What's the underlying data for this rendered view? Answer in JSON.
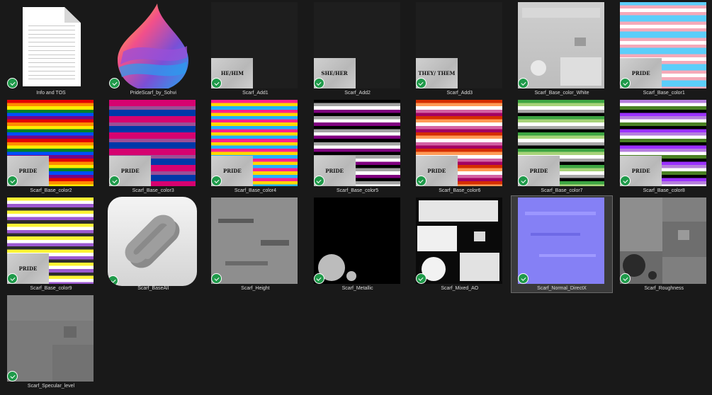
{
  "files": [
    {
      "label": "Info and TOS",
      "kind": "document",
      "icon": "document-icon"
    },
    {
      "label": "PrideScarf_by_Sohvi",
      "kind": "app",
      "icon": "paint-drop-icon"
    },
    {
      "label": "Scarf_Add1",
      "kind": "add",
      "badge": "HE/HIM"
    },
    {
      "label": "Scarf_Add2",
      "kind": "add",
      "badge": "SHE/HER"
    },
    {
      "label": "Scarf_Add3",
      "kind": "add",
      "badge": "THEY/ THEM"
    },
    {
      "label": "Scarf_Base_color_White",
      "kind": "white"
    },
    {
      "label": "Scarf_Base_color1",
      "kind": "stripes",
      "badge": "PRIDE",
      "colors": [
        "#5bcefa",
        "#f5a9b8",
        "#ffffff",
        "#f5a9b8",
        "#5bcefa"
      ]
    },
    {
      "label": "Scarf_Base_color2",
      "kind": "stripes",
      "badge": "PRIDE",
      "colors": [
        "#e40303",
        "#ff8c00",
        "#ffed00",
        "#008026",
        "#004dff",
        "#750787"
      ]
    },
    {
      "label": "Scarf_Base_color3",
      "kind": "stripes",
      "badge": "PRIDE",
      "colors": [
        "#d60270",
        "#d60270",
        "#9b4f96",
        "#0038a8",
        "#0038a8"
      ]
    },
    {
      "label": "Scarf_Base_color4",
      "kind": "stripes",
      "badge": "PRIDE",
      "colors": [
        "#ff218c",
        "#ffd800",
        "#21b1ff"
      ]
    },
    {
      "label": "Scarf_Base_color5",
      "kind": "stripes",
      "badge": "PRIDE",
      "colors": [
        "#000000",
        "#a3a3a3",
        "#ffffff",
        "#800080"
      ]
    },
    {
      "label": "Scarf_Base_color6",
      "kind": "stripes",
      "badge": "PRIDE",
      "colors": [
        "#d52d00",
        "#ff9a56",
        "#ffffff",
        "#d362a4",
        "#a30262"
      ]
    },
    {
      "label": "Scarf_Base_color7",
      "kind": "stripes",
      "badge": "PRIDE",
      "colors": [
        "#3da542",
        "#a7d379",
        "#ffffff",
        "#a9a9a9",
        "#000000"
      ]
    },
    {
      "label": "Scarf_Base_color8",
      "kind": "stripes",
      "badge": "PRIDE",
      "colors": [
        "#b57edc",
        "#ffffff",
        "#4a8123",
        "#000000",
        "#9b30ff"
      ]
    },
    {
      "label": "Scarf_Base_color9",
      "kind": "stripes",
      "badge": "PRIDE",
      "colors": [
        "#fcf434",
        "#ffffff",
        "#9c59d1",
        "#2c2c2c"
      ]
    },
    {
      "label": "Scarf_BaseAll",
      "kind": "clip",
      "icon": "clip-link-icon"
    },
    {
      "label": "Scarf_Height",
      "kind": "height"
    },
    {
      "label": "Scarf_Metallic",
      "kind": "metallic"
    },
    {
      "label": "Scarf_Mixed_AO",
      "kind": "ao"
    },
    {
      "label": "Scarf_Normal_DirectX",
      "kind": "normal",
      "selected": true
    },
    {
      "label": "Scarf_Roughness",
      "kind": "rough"
    },
    {
      "label": "Scarf_Specular_level",
      "kind": "spec"
    }
  ],
  "colors": {
    "background": "#191919",
    "check": "#1f9a4a",
    "selected": "#3a3a3a"
  }
}
